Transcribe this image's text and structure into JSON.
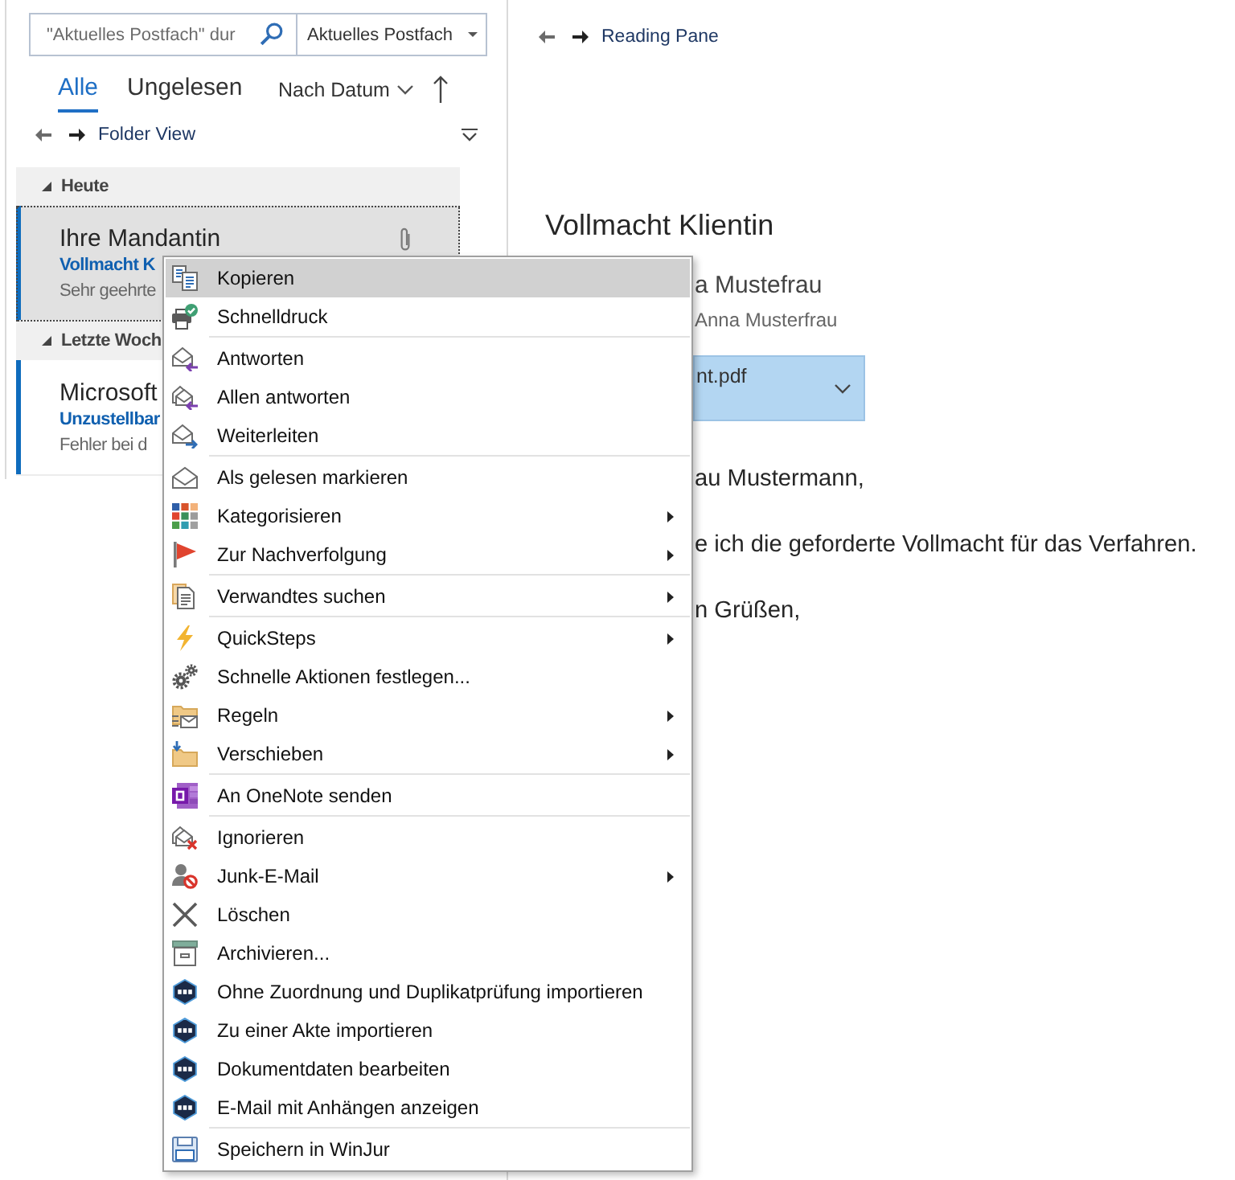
{
  "search": {
    "placeholder": "\"Aktuelles Postfach\" dur",
    "scope": "Aktuelles Postfach"
  },
  "view_tabs": [
    {
      "label": "Alle",
      "selected": true
    },
    {
      "label": "Ungelesen",
      "selected": false
    }
  ],
  "sort": {
    "label": "Nach Datum"
  },
  "folder_view": {
    "label": "Folder View"
  },
  "message_groups": [
    {
      "title": "Heute",
      "expanded": true,
      "messages": [
        {
          "sender": "Ihre Mandantin",
          "subject": "Vollmacht K",
          "preview": "Sehr geehrte",
          "unread": true,
          "selected": true,
          "has_attachment": true
        }
      ]
    },
    {
      "title": "Letzte Woch",
      "expanded": true,
      "messages": [
        {
          "sender": "Microsoft",
          "subject": "Unzustellbar",
          "preview": "Fehler bei d",
          "unread": true,
          "selected": false
        }
      ]
    }
  ],
  "reading_pane": {
    "label": "Reading Pane",
    "subject": "Vollmacht Klientin",
    "sender": "a Mustefrau",
    "recipient": "Anna Musterfrau",
    "attachment": {
      "name": "nt.pdf"
    },
    "body": [
      "au Mustermann,",
      "e ich die geforderte Vollmacht für das Verfahren.",
      "n Grüßen,"
    ]
  },
  "context_menu": {
    "groups": [
      {
        "items": [
          {
            "label": "Kopieren",
            "submenu": false,
            "selected": true
          },
          {
            "label": "Schnelldruck",
            "submenu": false,
            "selected": false
          }
        ]
      },
      {
        "items": [
          {
            "label": "Antworten",
            "submenu": false,
            "selected": false
          },
          {
            "label": "Allen antworten",
            "submenu": false,
            "selected": false
          },
          {
            "label": "Weiterleiten",
            "submenu": false,
            "selected": false
          }
        ]
      },
      {
        "items": [
          {
            "label": "Als gelesen markieren",
            "submenu": false,
            "selected": false
          },
          {
            "label": "Kategorisieren",
            "submenu": true,
            "selected": false
          },
          {
            "label": "Zur Nachverfolgung",
            "submenu": true,
            "selected": false
          }
        ]
      },
      {
        "items": [
          {
            "label": "Verwandtes suchen",
            "submenu": true,
            "selected": false
          }
        ]
      },
      {
        "items": [
          {
            "label": "QuickSteps",
            "submenu": true,
            "selected": false
          },
          {
            "label": "Schnelle Aktionen festlegen...",
            "submenu": false,
            "selected": false
          },
          {
            "label": "Regeln",
            "submenu": true,
            "selected": false
          },
          {
            "label": "Verschieben",
            "submenu": true,
            "selected": false
          }
        ]
      },
      {
        "items": [
          {
            "label": "An OneNote senden",
            "submenu": false,
            "selected": false
          }
        ]
      },
      {
        "items": [
          {
            "label": "Ignorieren",
            "submenu": false,
            "selected": false
          },
          {
            "label": "Junk-E-Mail",
            "submenu": true,
            "selected": false
          },
          {
            "label": "Löschen",
            "submenu": false,
            "selected": false
          },
          {
            "label": "Archivieren...",
            "submenu": false,
            "selected": false
          },
          {
            "label": "Ohne Zuordnung und Duplikatprüfung importieren",
            "submenu": false,
            "selected": false
          },
          {
            "label": "Zu einer Akte importieren",
            "submenu": false,
            "selected": false
          },
          {
            "label": "Dokumentdaten bearbeiten",
            "submenu": false,
            "selected": false
          },
          {
            "label": "E-Mail mit Anhängen anzeigen",
            "submenu": false,
            "selected": false
          }
        ]
      },
      {
        "items": [
          {
            "label": "Speichern in WinJur",
            "submenu": false,
            "selected": false
          }
        ]
      }
    ]
  }
}
